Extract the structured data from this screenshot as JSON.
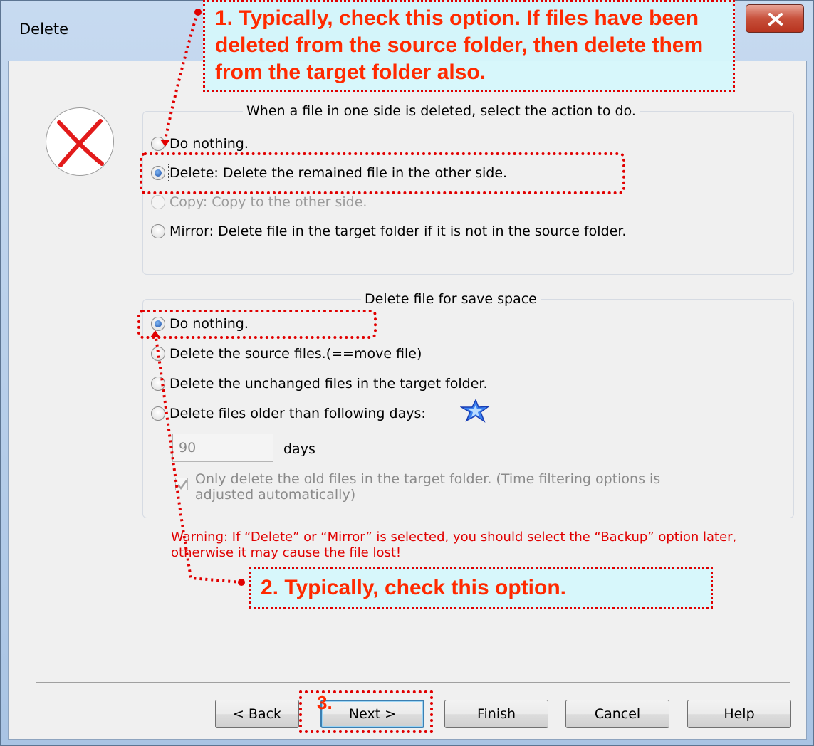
{
  "window": {
    "title": "Delete"
  },
  "delete_group": {
    "legend": "When a file in one side is deleted, select the action to do.",
    "options": [
      {
        "label": "Do nothing.",
        "checked": false,
        "disabled": false
      },
      {
        "label": "Delete: Delete the remained file in the other side.",
        "checked": true,
        "disabled": false
      },
      {
        "label": "Copy: Copy to the other side.",
        "checked": false,
        "disabled": true
      },
      {
        "label": "Mirror: Delete file in the target folder if it is not in the source folder.",
        "checked": false,
        "disabled": false
      }
    ]
  },
  "save_group": {
    "legend": "Delete file for save space",
    "options": [
      {
        "label": "Do nothing.",
        "checked": true
      },
      {
        "label": "Delete the source files.(==move file)",
        "checked": false
      },
      {
        "label": "Delete the unchanged files in the target folder.",
        "checked": false
      },
      {
        "label": "Delete files older than following days:",
        "checked": false
      }
    ],
    "days_value": "90",
    "days_unit": "days",
    "old_files_checkbox": {
      "label": "Only delete the old files in the target folder. (Time filtering options is adjusted automatically)",
      "checked": true,
      "disabled": true
    }
  },
  "warning": "Warning: If “Delete” or “Mirror” is selected, you should select the “Backup” option later, otherwise it may cause the file lost!",
  "buttons": {
    "back": "< Back",
    "next": "Next >",
    "finish": "Finish",
    "cancel": "Cancel",
    "help": "Help"
  },
  "annotations": {
    "callout1": "1. Typically, check this option. If files have been deleted from the source folder, then delete them from the target folder also.",
    "callout2": "2. Typically, check this option.",
    "callout3": "3."
  },
  "icons": {
    "delete_icon": "red-x-icon",
    "new_feature_icon": "blue-star-icon",
    "close_icon": "close-icon"
  },
  "colors": {
    "annotation_red": "#e10000",
    "annotation_text": "#ff2a00",
    "callout_bg": "#d5f6fb",
    "warning_text": "#e00000"
  }
}
